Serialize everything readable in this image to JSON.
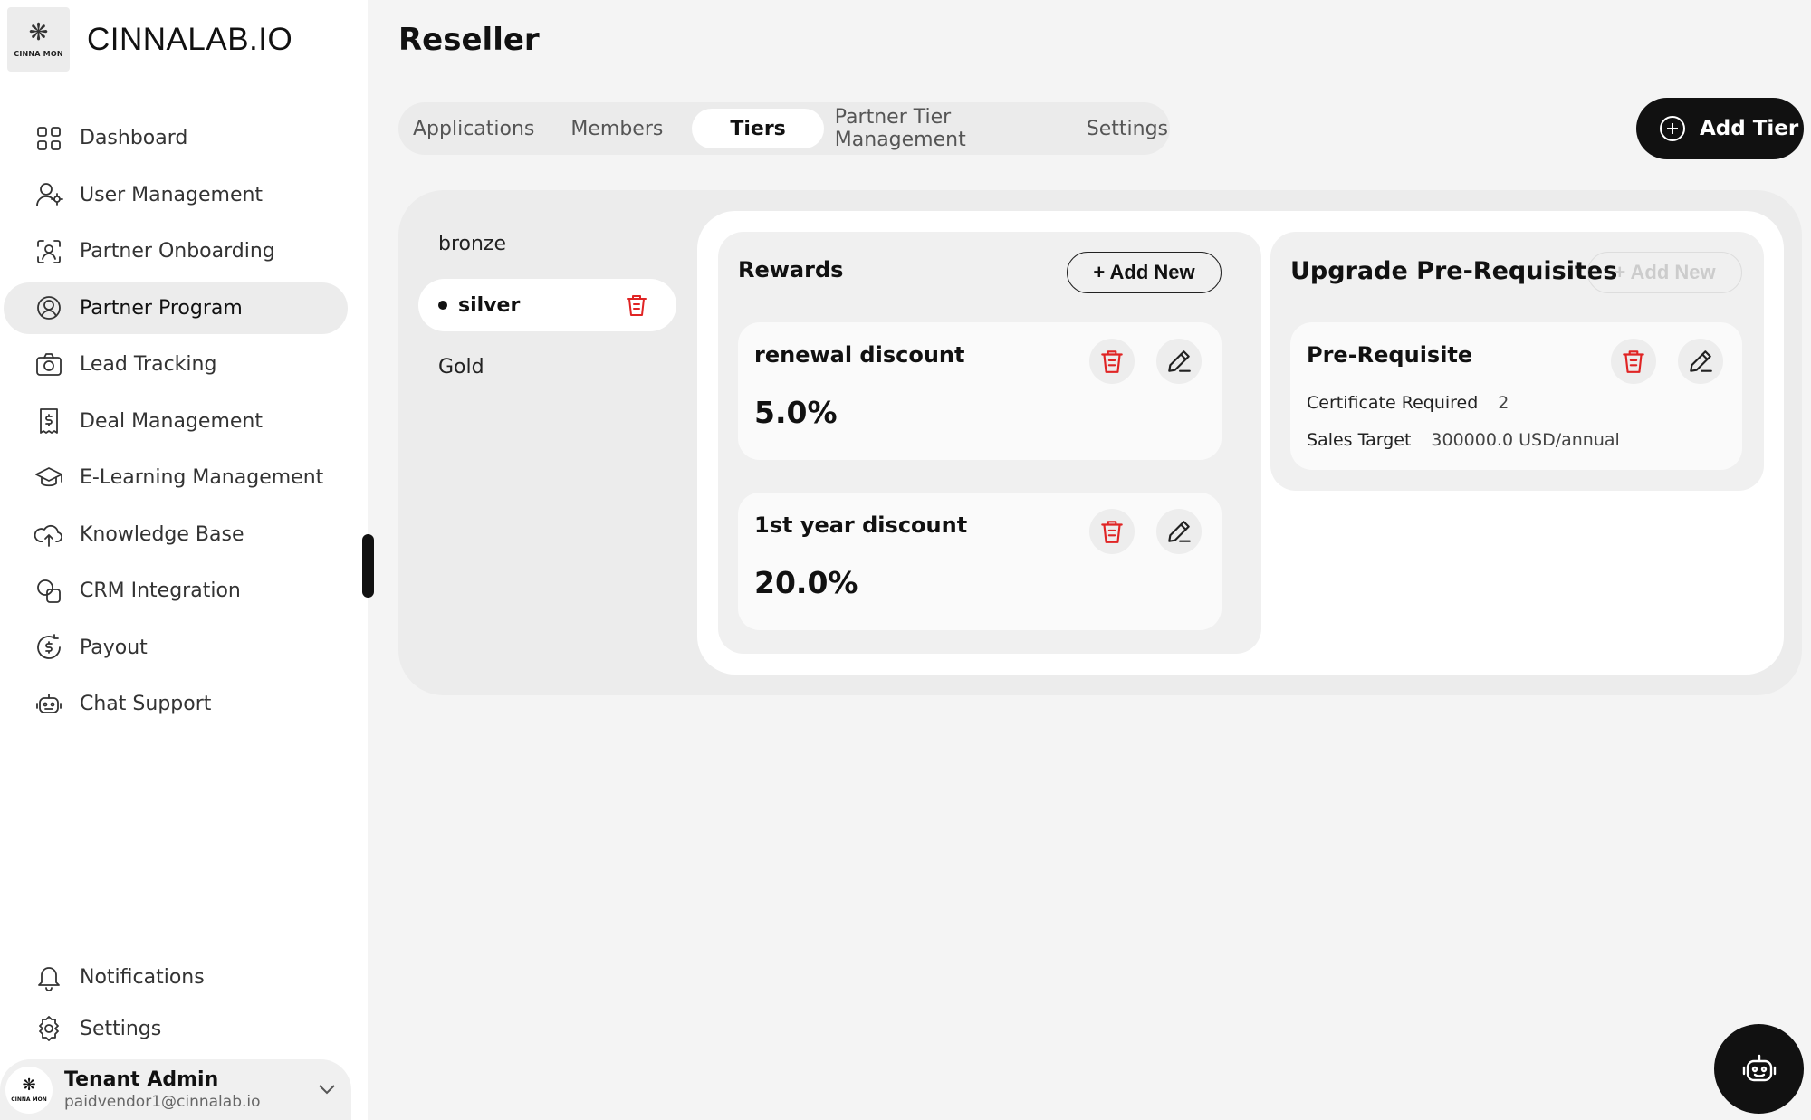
{
  "brand": {
    "name": "CINNALAB.IO",
    "logo_text": "CINNA MON"
  },
  "sidebar": {
    "items": [
      {
        "label": "Dashboard",
        "icon": "dashboard-icon"
      },
      {
        "label": "User Management",
        "icon": "user-management-icon"
      },
      {
        "label": "Partner Onboarding",
        "icon": "partner-onboarding-icon"
      },
      {
        "label": "Partner Program",
        "icon": "partner-program-icon",
        "active": true
      },
      {
        "label": "Lead Tracking",
        "icon": "lead-tracking-icon"
      },
      {
        "label": "Deal Management",
        "icon": "deal-management-icon"
      },
      {
        "label": "E-Learning Management",
        "icon": "graduation-cap-icon"
      },
      {
        "label": "Knowledge Base",
        "icon": "cloud-upload-icon"
      },
      {
        "label": "CRM Integration",
        "icon": "crm-integration-icon"
      },
      {
        "label": "Payout",
        "icon": "payout-icon"
      },
      {
        "label": "Chat Support",
        "icon": "robot-icon"
      }
    ],
    "bottom": [
      {
        "label": "Notifications",
        "icon": "bell-icon"
      },
      {
        "label": "Settings",
        "icon": "gear-icon"
      }
    ]
  },
  "user": {
    "name": "Tenant Admin",
    "email": "paidvendor1@cinnalab.io",
    "avatar_text": "CINNA MON"
  },
  "page": {
    "title": "Reseller"
  },
  "tabs": [
    {
      "label": "Applications"
    },
    {
      "label": "Members"
    },
    {
      "label": "Tiers",
      "active": true
    },
    {
      "label": "Partner Tier Management"
    },
    {
      "label": "Settings"
    }
  ],
  "add_tier_label": "Add Tier",
  "tiers": [
    {
      "name": "bronze"
    },
    {
      "name": "silver",
      "active": true
    },
    {
      "name": "Gold"
    }
  ],
  "rewards": {
    "title": "Rewards",
    "add_label": "+ Add New",
    "items": [
      {
        "title": "renewal discount",
        "value": "5.0%"
      },
      {
        "title": "1st year discount",
        "value": "20.0%"
      }
    ]
  },
  "prereqs": {
    "title": "Upgrade Pre-Requisites",
    "add_label": "+ Add New",
    "items": [
      {
        "title": "Pre-Requisite",
        "certificate_label": "Certificate Required",
        "certificate_value": "2",
        "sales_label": "Sales Target",
        "sales_value": "300000.0 USD/annual"
      }
    ]
  },
  "colors": {
    "accent": "#111111",
    "danger": "#e02424",
    "sidebar_active": "#ececec"
  }
}
